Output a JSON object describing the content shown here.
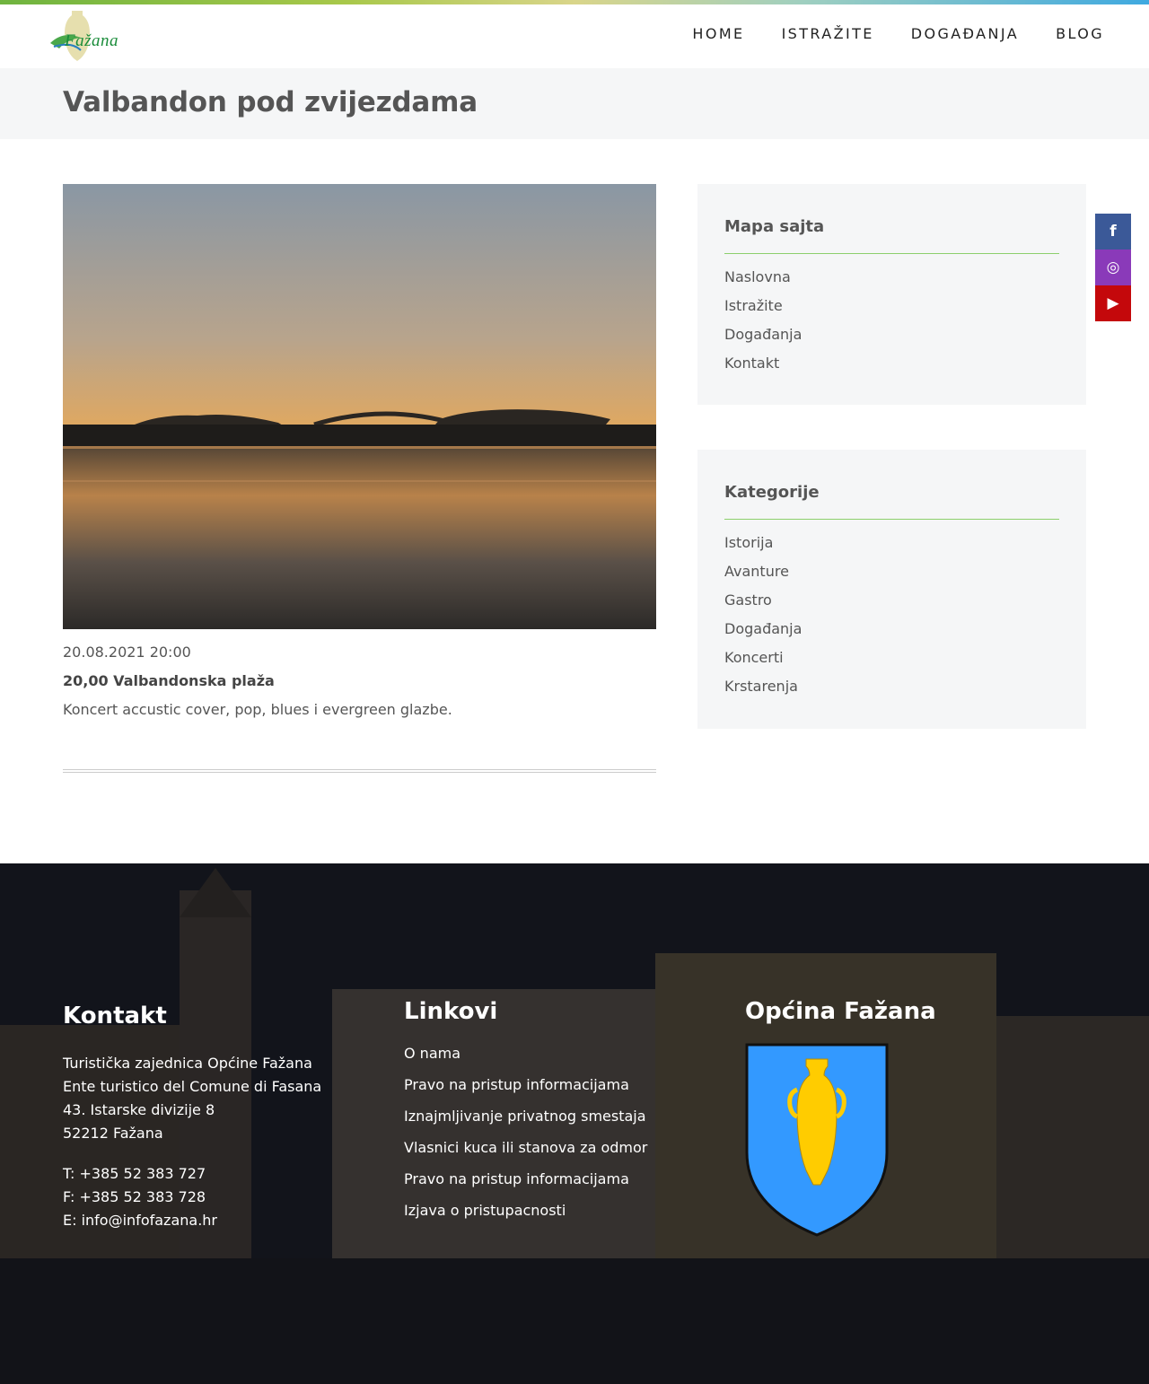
{
  "header": {
    "logo_text": "Fažana",
    "nav": [
      "HOME",
      "ISTRAŽITE",
      "DOGAĐANJA",
      "BLOG"
    ]
  },
  "page": {
    "title": "Valbandon pod zvijezdama"
  },
  "event": {
    "datetime": "20.08.2021 20:00",
    "subtitle": "20,00 Valbandonska plaža",
    "description": "Koncert accustic cover, pop, blues i evergreen glazbe."
  },
  "sidebar": {
    "sitemap": {
      "title": "Mapa sajta",
      "items": [
        "Naslovna",
        "Istražite",
        "Događanja",
        "Kontakt"
      ]
    },
    "categories": {
      "title": "Kategorije",
      "items": [
        "Istorija",
        "Avanture",
        "Gastro",
        "Događanja",
        "Koncerti",
        "Krstarenja"
      ]
    }
  },
  "social": [
    {
      "icon": "facebook-icon",
      "glyph": "f",
      "color": "#3b5998"
    },
    {
      "icon": "instagram-icon",
      "glyph": "◎",
      "color": "#8a3ab9"
    },
    {
      "icon": "youtube-icon",
      "glyph": "▶",
      "color": "#c4080b"
    }
  ],
  "footer": {
    "contact": {
      "title": "Kontakt",
      "lines": [
        "Turistička zajednica Općine Fažana",
        "Ente turistico del Comune di Fasana",
        "43. Istarske divizije 8",
        "52212 Fažana"
      ],
      "phone": "T: +385 52 383 727",
      "fax": "F: +385 52 383 728",
      "email": "E: info@infofazana.hr"
    },
    "links": {
      "title": "Linkovi",
      "items": [
        "O nama",
        "Pravo na pristup informacijama",
        "Iznajmljivanje privatnog smestaja",
        "Vlasnici kuca ili stanova za odmor",
        "Pravo na pristup informacijama",
        "Izjava o pristupacnosti"
      ]
    },
    "municipality": {
      "title": "Općina Fažana"
    }
  },
  "colors": {
    "accent_line": "#8ccf6c",
    "crest_blue": "#3399ff",
    "crest_gold": "#ffcc00"
  }
}
